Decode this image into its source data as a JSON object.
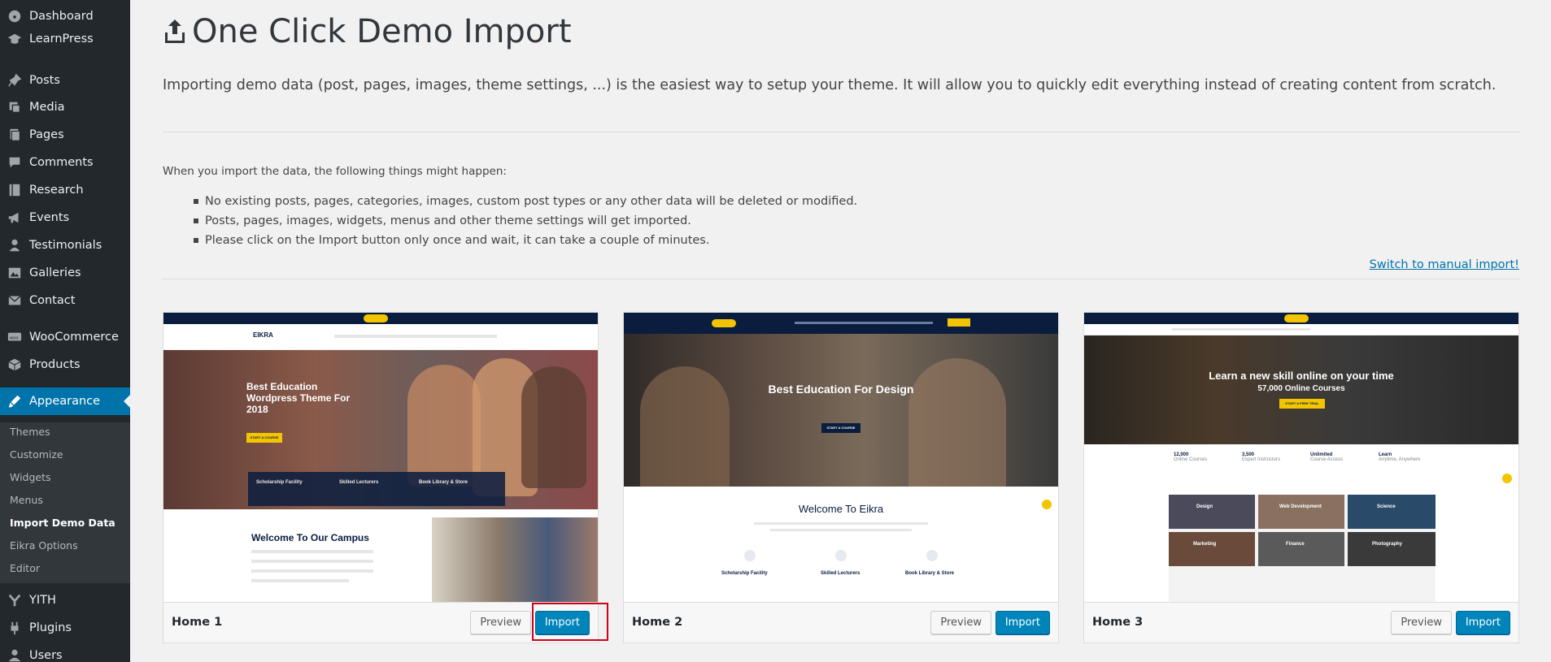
{
  "sidebar": {
    "items": [
      {
        "label": "Dashboard",
        "icon": "dashboard-icon"
      },
      {
        "label": "LearnPress",
        "icon": "graduation-cap-icon"
      },
      {
        "label": "Posts",
        "icon": "pin-icon"
      },
      {
        "label": "Media",
        "icon": "media-icon"
      },
      {
        "label": "Pages",
        "icon": "pages-icon"
      },
      {
        "label": "Comments",
        "icon": "comments-icon"
      },
      {
        "label": "Research",
        "icon": "book-icon"
      },
      {
        "label": "Events",
        "icon": "megaphone-icon"
      },
      {
        "label": "Testimonials",
        "icon": "testimonial-icon"
      },
      {
        "label": "Galleries",
        "icon": "gallery-icon"
      },
      {
        "label": "Contact",
        "icon": "email-icon"
      },
      {
        "label": "WooCommerce",
        "icon": "woo-icon"
      },
      {
        "label": "Products",
        "icon": "archive-icon"
      },
      {
        "label": "Appearance",
        "icon": "brush-icon"
      },
      {
        "label": "YITH",
        "icon": "yith-icon"
      },
      {
        "label": "Plugins",
        "icon": "plugin-icon"
      },
      {
        "label": "Users",
        "icon": "users-icon"
      }
    ],
    "submenu": [
      "Themes",
      "Customize",
      "Widgets",
      "Menus",
      "Import Demo Data",
      "Eikra Options",
      "Editor"
    ],
    "active_color": "#0073aa"
  },
  "main": {
    "title": "One Click Demo Import",
    "intro": "Importing demo data (post, pages, images, theme settings, ...) is the easiest way to setup your theme. It will allow you to quickly edit everything instead of creating content from scratch.",
    "lead": "When you import the data, the following things might happen:",
    "notes": [
      "No existing posts, pages, categories, images, custom post types or any other data will be deleted or modified.",
      "Posts, pages, images, widgets, menus and other theme settings will get imported.",
      "Please click on the Import button only once and wait, it can take a couple of minutes."
    ],
    "manual_link": "Switch to manual import!"
  },
  "demos": [
    {
      "name": "Home 1",
      "preview": "Preview",
      "import": "Import",
      "shot": {
        "hero_title": "Best Education Wordpress Theme For 2018",
        "hero_btn": "START A COURSE",
        "features": [
          "Scholarship Facility",
          "Skilled Lecturers",
          "Book Library & Store"
        ],
        "section": "Welcome To Our Campus"
      }
    },
    {
      "name": "Home 2",
      "preview": "Preview",
      "import": "Import",
      "shot": {
        "hero_title": "Best Education For Design",
        "hero_btn": "START A COURSE",
        "section": "Welcome To Eikra",
        "features": [
          "Scholarship Facility",
          "Skilled Lecturers",
          "Book Library & Store"
        ]
      }
    },
    {
      "name": "Home 3",
      "preview": "Preview",
      "import": "Import",
      "shot": {
        "hero_title": "Learn a new skill online on your time",
        "hero_sub": "57,000 Online Courses",
        "hero_btn": "START A FREE TRIAL",
        "stats": [
          {
            "value": "12,000",
            "label": "Online Courses"
          },
          {
            "value": "3,500",
            "label": "Expert Instructors"
          },
          {
            "value": "Unlimited",
            "label": "Course Access"
          },
          {
            "value": "Learn",
            "label": "Anytime, Anywhere"
          }
        ],
        "tiles": [
          "Design",
          "Web Development",
          "Science",
          "Marketing",
          "Finance",
          "Photography"
        ]
      }
    }
  ],
  "brand": "EIKRA"
}
